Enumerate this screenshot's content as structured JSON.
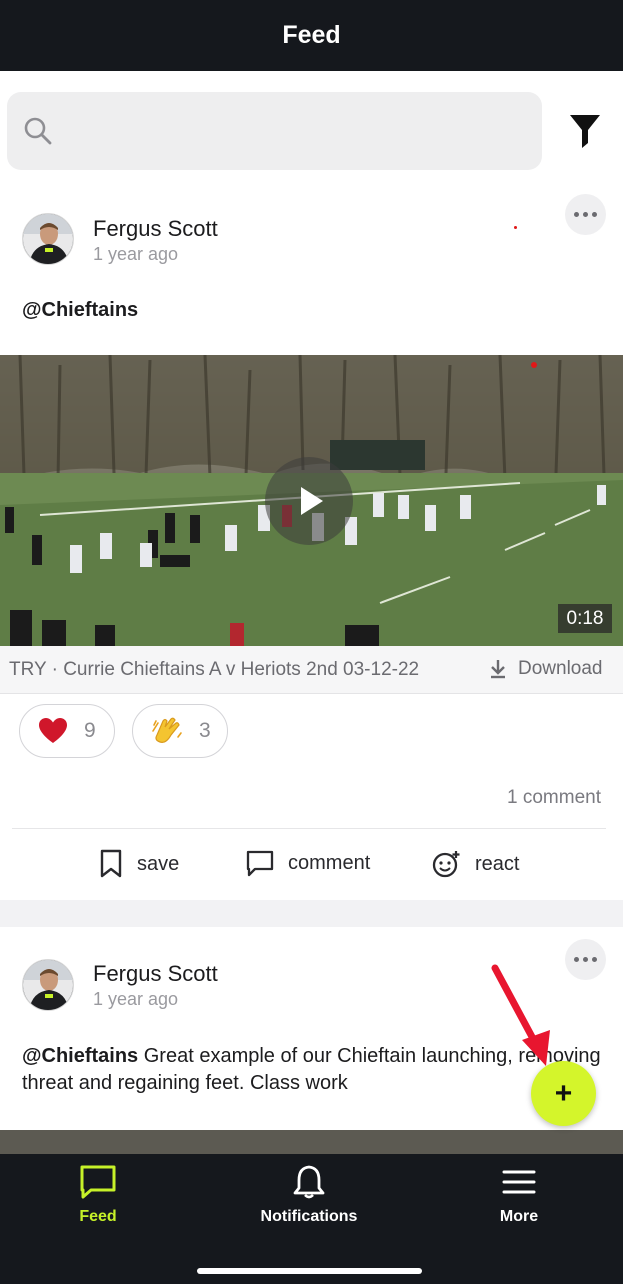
{
  "header": {
    "title": "Feed"
  },
  "search": {
    "placeholder": "",
    "value": ""
  },
  "posts": [
    {
      "author": "Fergus Scott",
      "time": "1 year ago",
      "mention": "@Chieftains",
      "text": "",
      "video": {
        "duration": "0:18",
        "caption": "TRY · Currie Chieftains A v Heriots 2nd 03-12-22",
        "download_label": "Download"
      },
      "reactions": [
        {
          "icon": "heart-icon",
          "count": "9",
          "color": "#d0172b"
        },
        {
          "icon": "clapping-hands-icon",
          "count": "3",
          "color": "#f4c430"
        }
      ],
      "comment_count": "1 comment",
      "actions": [
        {
          "icon": "bookmark-icon",
          "label": "save"
        },
        {
          "icon": "comment-icon",
          "label": "comment"
        },
        {
          "icon": "react-smiley-icon",
          "label": "react"
        }
      ]
    },
    {
      "author": "Fergus Scott",
      "time": "1 year ago",
      "mention": "@Chieftains",
      "text": " Great example of our Chieftain launching, removing threat and regaining feet. Class work"
    }
  ],
  "fab": {
    "label": "+",
    "color": "#d4f52b"
  },
  "tabs": [
    {
      "icon": "chat-bubble-icon",
      "label": "Feed",
      "active": true
    },
    {
      "icon": "bell-icon",
      "label": "Notifications",
      "active": false
    },
    {
      "icon": "menu-icon",
      "label": "More",
      "active": false
    }
  ],
  "colors": {
    "accent": "#c6f129",
    "bar": "#15181d",
    "annotation_arrow": "#e8162f"
  }
}
